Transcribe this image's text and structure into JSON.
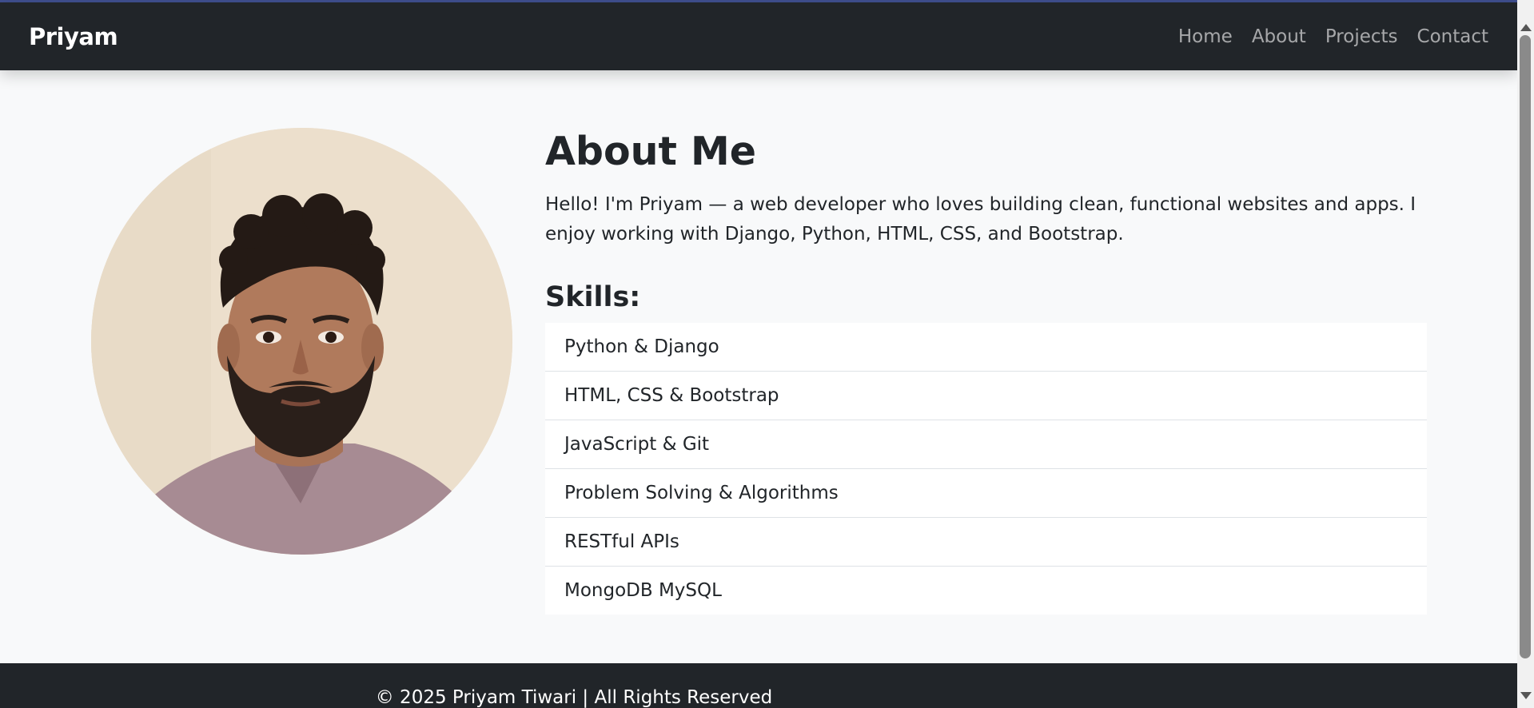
{
  "navbar": {
    "brand": "Priyam",
    "links": [
      "Home",
      "About",
      "Projects",
      "Contact"
    ]
  },
  "about": {
    "heading": "About Me",
    "intro": "Hello! I'm Priyam — a web developer who loves building clean, functional websites and apps. I enjoy working with Django, Python, HTML, CSS, and Bootstrap.",
    "skills_heading": "Skills:",
    "skills": [
      "Python & Django",
      "HTML, CSS & Bootstrap",
      "JavaScript & Git",
      "Problem Solving & Algorithms",
      "RESTful APIs",
      "MongoDB MySQL"
    ]
  },
  "footer": {
    "text": "© 2025 Priyam Tiwari | All Rights Reserved"
  },
  "colors": {
    "navbar_bg": "#212529",
    "page_bg": "#f8f9fa",
    "nav_link": "rgba(255,255,255,0.6)"
  },
  "icons": {
    "profile_photo": "profile-photo"
  }
}
